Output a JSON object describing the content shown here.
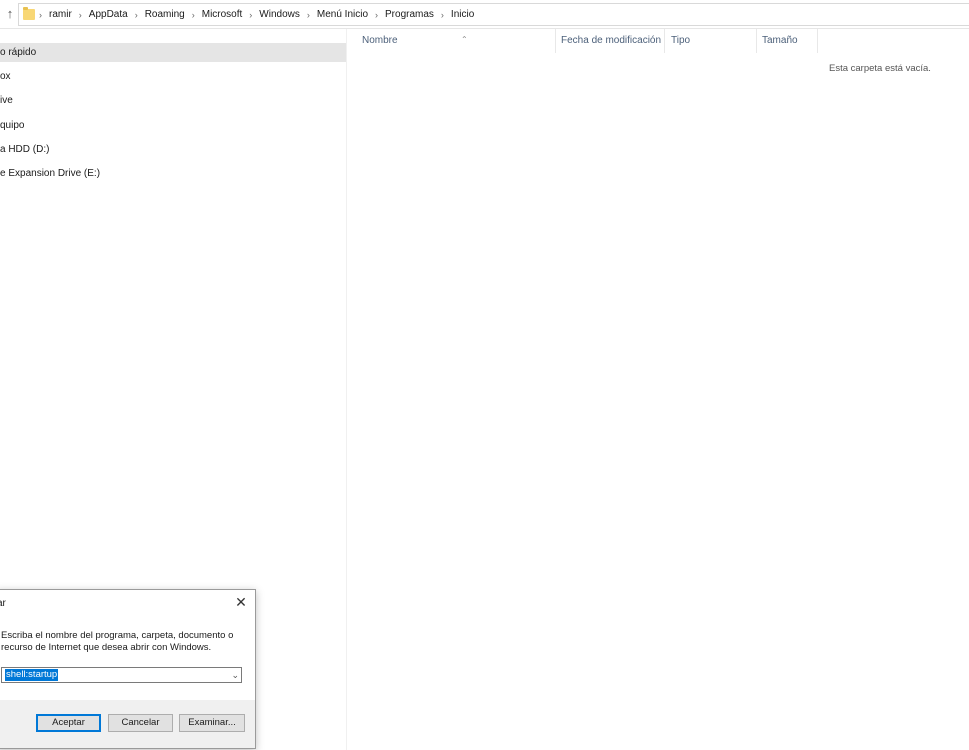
{
  "address_bar": {
    "breadcrumbs": [
      "ramir",
      "AppData",
      "Roaming",
      "Microsoft",
      "Windows",
      "Menú Inicio",
      "Programas",
      "Inicio"
    ]
  },
  "nav_pane": {
    "items": [
      {
        "label": "o rápido",
        "selected": true
      },
      {
        "label": "ox"
      },
      {
        "label": "ive"
      },
      {
        "label": "quipo"
      },
      {
        "label": "a HDD (D:)"
      },
      {
        "label": "e Expansion Drive (E:)"
      }
    ]
  },
  "file_list": {
    "columns": [
      "Nombre",
      "Fecha de modificación",
      "Tipo",
      "Tamaño"
    ],
    "empty_message": "Esta carpeta está vacía."
  },
  "run_dialog": {
    "title": "ar",
    "description_line1": "Escriba el nombre del programa, carpeta, documento o",
    "description_line2": "recurso de Internet que desea abrir con Windows.",
    "input_value": "shell:startup",
    "buttons": {
      "ok": "Aceptar",
      "cancel": "Cancelar",
      "browse": "Examinar..."
    }
  },
  "colors": {
    "folder_icon": "#f8d775",
    "selection": "#0078d7",
    "nav_selected_bg": "#e5e5e5",
    "column_header_text": "#4c607a"
  }
}
